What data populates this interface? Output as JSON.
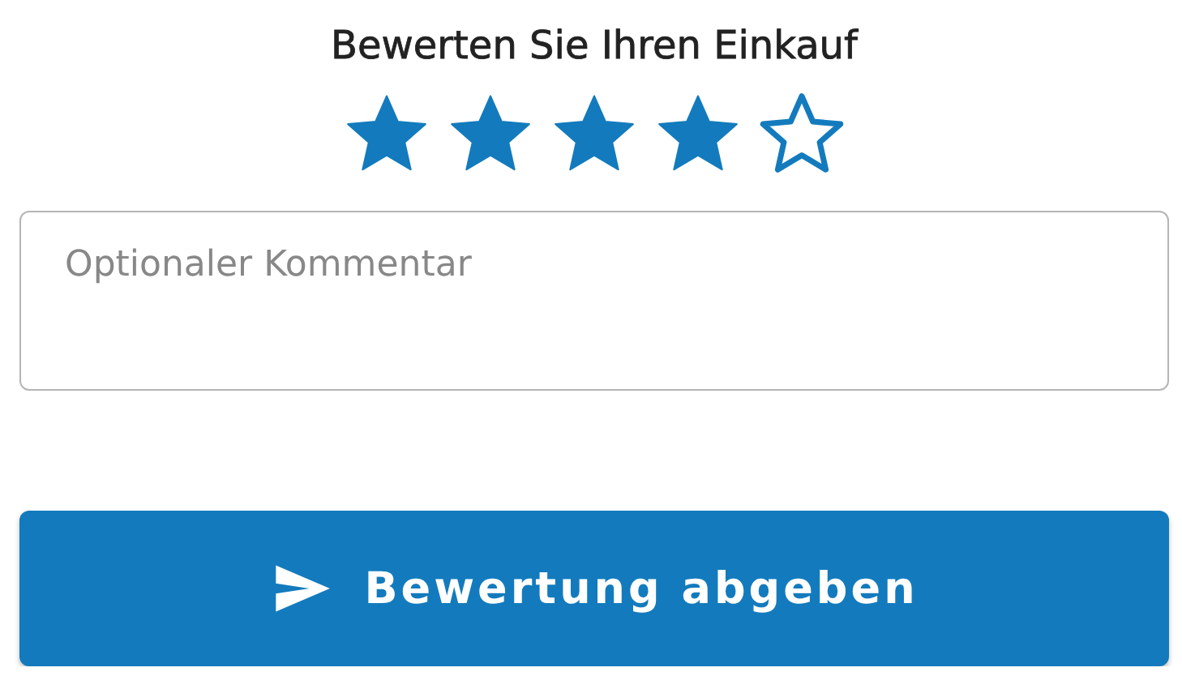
{
  "title": "Bewerten Sie Ihren Einkauf",
  "rating": {
    "stars": 4
  },
  "comment": {
    "placeholder": "Optionaler Kommentar"
  },
  "submit": {
    "label": "Bewertung abgeben"
  }
}
